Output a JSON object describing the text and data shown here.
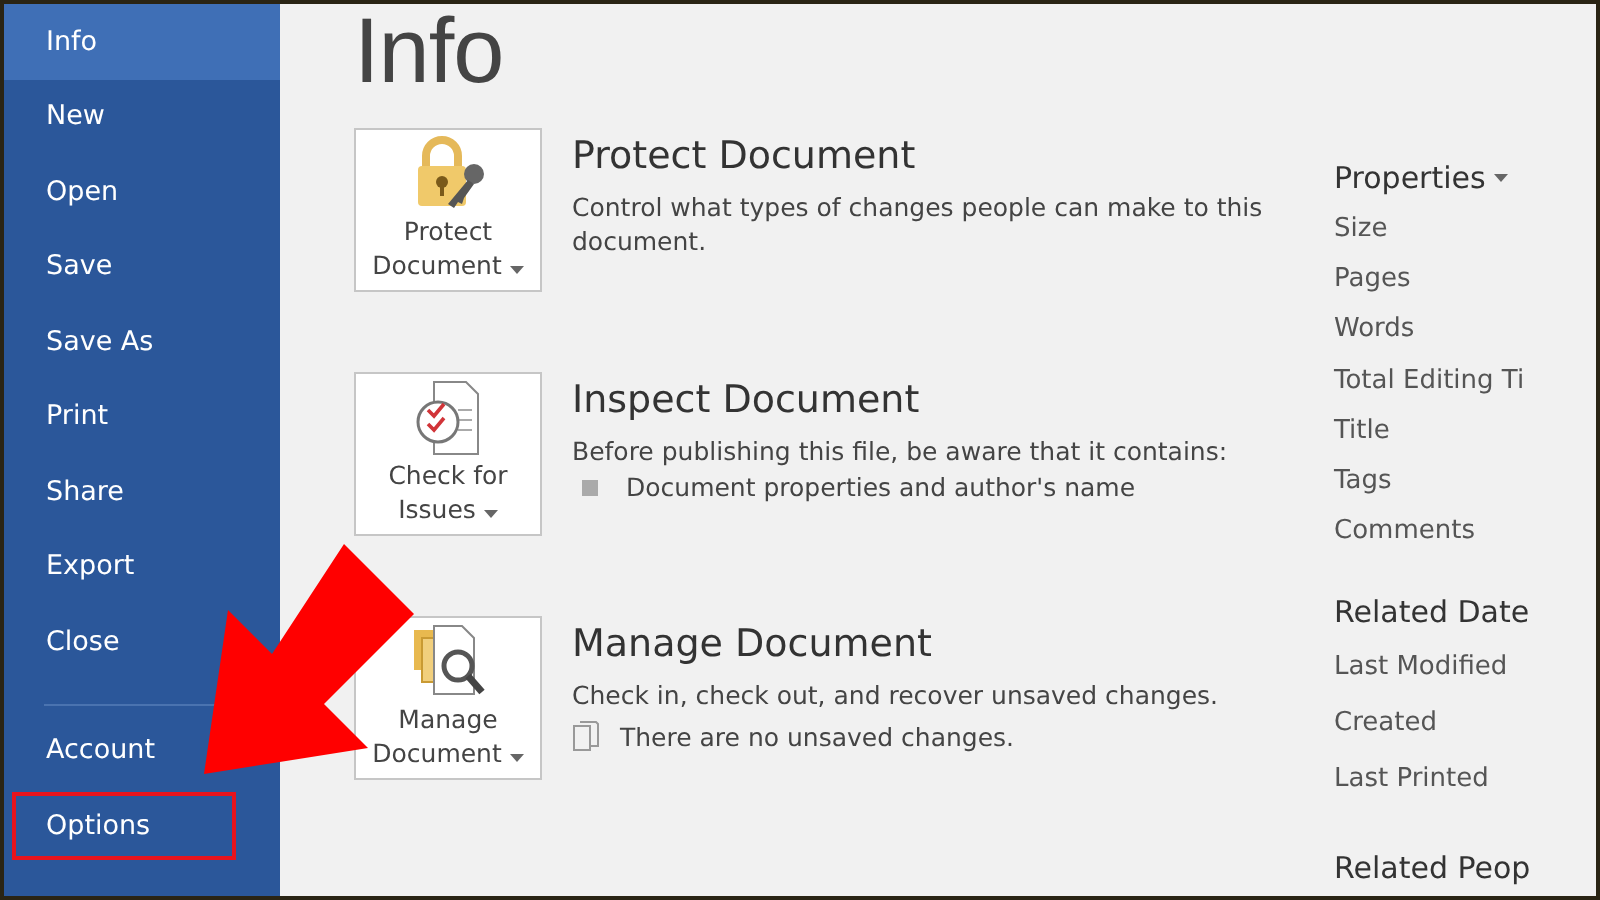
{
  "sidebar": {
    "items": [
      {
        "label": "Info",
        "selected": true,
        "highlighted": false
      },
      {
        "label": "New",
        "selected": false,
        "highlighted": false
      },
      {
        "label": "Open",
        "selected": false,
        "highlighted": false
      },
      {
        "label": "Save",
        "selected": false,
        "highlighted": false
      },
      {
        "label": "Save As",
        "selected": false,
        "highlighted": false
      },
      {
        "label": "Print",
        "selected": false,
        "highlighted": false
      },
      {
        "label": "Share",
        "selected": false,
        "highlighted": false
      },
      {
        "label": "Export",
        "selected": false,
        "highlighted": false
      },
      {
        "label": "Close",
        "selected": false,
        "highlighted": false
      },
      {
        "label": "Account",
        "selected": false,
        "highlighted": false,
        "divider_before": true
      },
      {
        "label": "Options",
        "selected": false,
        "highlighted": true
      }
    ]
  },
  "pointer_arrow": true,
  "page_title": "Info",
  "sections": [
    {
      "kind": "protect",
      "button": [
        "Protect",
        "Document"
      ],
      "title": "Protect Document",
      "description": "Control what types of changes people can make to this document."
    },
    {
      "kind": "inspect",
      "button": [
        "Check for",
        "Issues"
      ],
      "title": "Inspect Document",
      "description": "Before publishing this file, be aware that it contains:",
      "bullets": [
        "Document properties and author's name"
      ]
    },
    {
      "kind": "manage",
      "button": [
        "Manage",
        "Document"
      ],
      "title": "Manage Document",
      "description": "Check in, check out, and recover unsaved changes.",
      "note": "There are no unsaved changes."
    }
  ],
  "properties": {
    "heading": "Properties",
    "items": [
      "Size",
      "Pages",
      "Words",
      "Total Editing Ti",
      "Title",
      "Tags",
      "Comments"
    ]
  },
  "related_dates": {
    "heading": "Related Date",
    "items": [
      "Last Modified",
      "Created",
      "Last Printed"
    ]
  },
  "related_people": {
    "heading": "Related Peop"
  }
}
